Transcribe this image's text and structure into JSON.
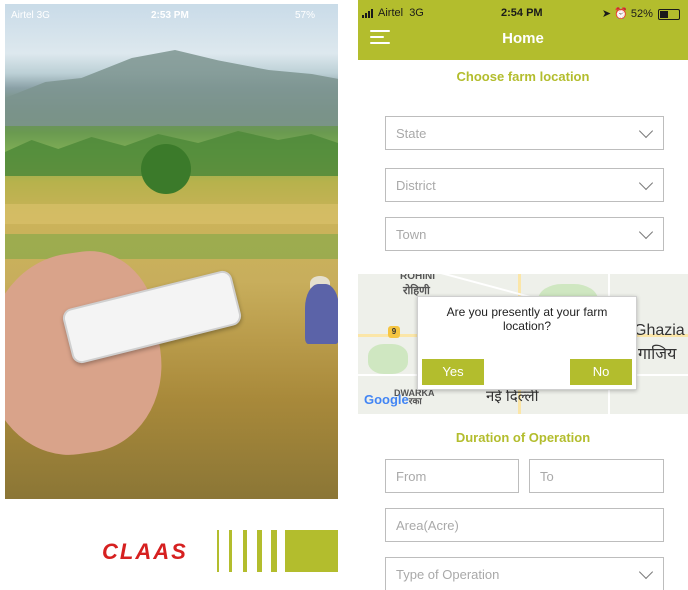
{
  "splash": {
    "status": {
      "carrier": "Airtel",
      "network": "3G",
      "time": "2:53 PM",
      "battery": "57%"
    },
    "logo_text": "CLAAS"
  },
  "home": {
    "status": {
      "carrier": "Airtel",
      "network": "3G",
      "time": "2:54 PM",
      "battery": "52%",
      "battery_level": 0.52
    },
    "title": "Home",
    "menu_icon": "hamburger-menu-icon",
    "farm_location": {
      "heading": "Choose farm location",
      "state_placeholder": "State",
      "district_placeholder": "District",
      "town_placeholder": "Town"
    },
    "map": {
      "labels": {
        "rohini": "ROHINI",
        "rohini_hi": "रोहिणी",
        "ghazia": "Ghazia",
        "ghazia_hi": "गाजिय",
        "dwarka": "DWARKA",
        "new_delhi_hi": "नई दिल्ली",
        "highway": "9",
        "google": "Google",
        "dwarka_hi": "रका"
      }
    },
    "dialog": {
      "question": "Are you presently at your farm location?",
      "yes_label": "Yes",
      "no_label": "No"
    },
    "duration": {
      "heading": "Duration of Operation",
      "from_placeholder": "From",
      "to_placeholder": "To",
      "area_placeholder": "Area(Acre)",
      "type_placeholder": "Type of Operation"
    }
  },
  "colors": {
    "accent": "#b3bd2d",
    "logo_red": "#d62020"
  }
}
